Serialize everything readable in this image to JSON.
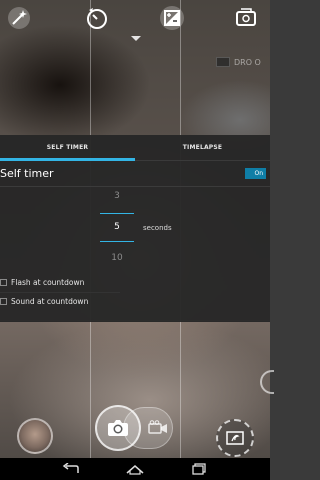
{
  "panel": {
    "tabs": [
      {
        "label": "SELF TIMER",
        "active": true
      },
      {
        "label": "TIMELAPSE",
        "active": false
      }
    ],
    "self_timer": {
      "title": "Self timer",
      "switch_label": "On",
      "picker": {
        "prev": "3",
        "current": "5",
        "next": "10",
        "unit": "seconds"
      }
    },
    "options": [
      {
        "label": "Flash at countdown",
        "checked": false
      },
      {
        "label": "Sound at countdown",
        "checked": false
      }
    ]
  },
  "top_bar": {
    "icons": [
      "magic-wand-icon",
      "timer-icon",
      "exposure-icon",
      "switch-camera-icon"
    ],
    "toggle_label": "DRO O"
  },
  "colors": {
    "accent": "#33b5e5",
    "switch_on": "#0f7ea6"
  }
}
